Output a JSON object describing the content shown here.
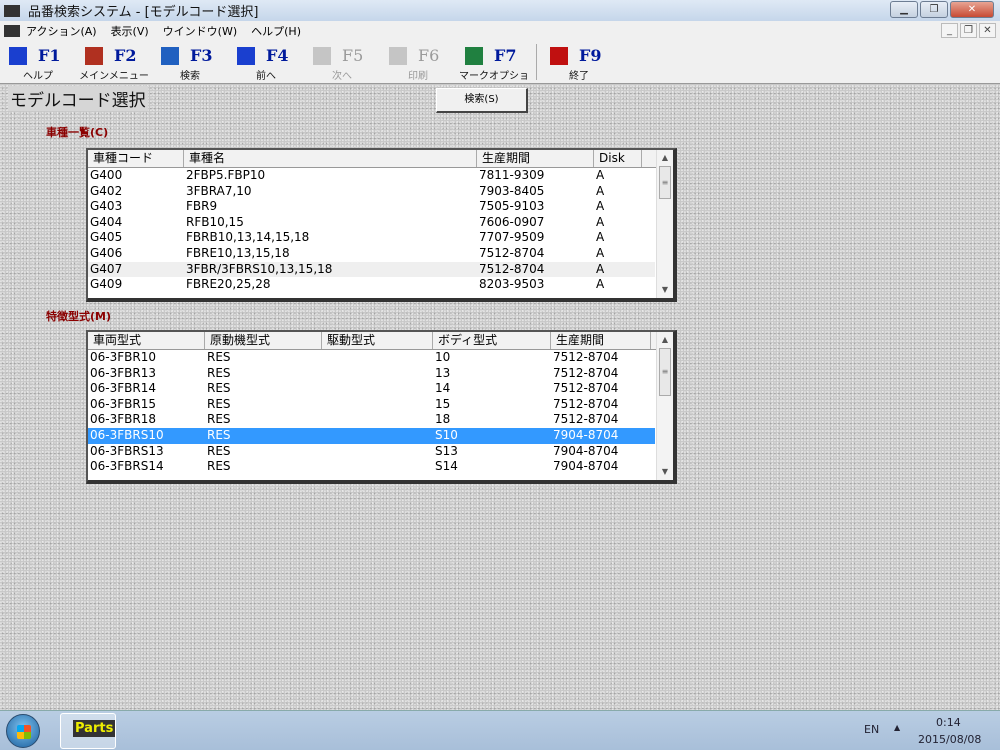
{
  "window": {
    "title": "品番検索システム - [モデルコード選択]",
    "app_icon": "Parts"
  },
  "menu": [
    "アクション(A)",
    "表示(V)",
    "ウインドウ(W)",
    "ヘルプ(H)"
  ],
  "toolbar": [
    {
      "key": "F1",
      "label": "ヘルプ",
      "icon": "help-icon",
      "enabled": true,
      "color": "#1a3fcf"
    },
    {
      "key": "F2",
      "label": "メインメニュー",
      "icon": "home-icon",
      "enabled": true,
      "color": "#b03020"
    },
    {
      "key": "F3",
      "label": "検索",
      "icon": "search-icon",
      "enabled": true,
      "color": "#2060c0"
    },
    {
      "key": "F4",
      "label": "前へ",
      "icon": "back-icon",
      "enabled": true,
      "color": "#1a3fcf"
    },
    {
      "key": "F5",
      "label": "次へ",
      "icon": "next-icon",
      "enabled": false,
      "color": "#999999"
    },
    {
      "key": "F6",
      "label": "印刷",
      "icon": "print-icon",
      "enabled": false,
      "color": "#999999"
    },
    {
      "key": "F7",
      "label": "マークオプション",
      "icon": "mark-option-icon",
      "enabled": true,
      "color": "#208040"
    },
    {
      "key": "F9",
      "label": "終了",
      "icon": "exit-icon",
      "enabled": true,
      "color": "#c01010"
    }
  ],
  "page": {
    "title": "モデルコード選択",
    "search_button": "検索(S)"
  },
  "model_list": {
    "label": "車種一覧(C)",
    "columns": [
      "車種コード",
      "車種名",
      "生産期間",
      "Disk"
    ],
    "rows": [
      [
        "G400",
        "2FBP5.FBP10",
        "7811-9309",
        "A"
      ],
      [
        "G402",
        "3FBRA7,10",
        "7903-8405",
        "A"
      ],
      [
        "G403",
        "FBR9",
        "7505-9103",
        "A"
      ],
      [
        "G404",
        "RFB10,15",
        "7606-0907",
        "A"
      ],
      [
        "G405",
        "FBRB10,13,14,15,18",
        "7707-9509",
        "A"
      ],
      [
        "G406",
        "FBRE10,13,15,18",
        "7512-8704",
        "A"
      ],
      [
        "G407",
        "3FBR/3FBRS10,13,15,18",
        "7512-8704",
        "A"
      ],
      [
        "G409",
        "FBRE20,25,28",
        "8203-9503",
        "A"
      ]
    ],
    "highlighted_row": 6
  },
  "type_list": {
    "label": "特徴型式(M)",
    "columns": [
      "車両型式",
      "原動機型式",
      "駆動型式",
      "ボディ型式",
      "生産期間"
    ],
    "rows": [
      [
        "06-3FBR10",
        "RES",
        "",
        "10",
        "7512-8704"
      ],
      [
        "06-3FBR13",
        "RES",
        "",
        "13",
        "7512-8704"
      ],
      [
        "06-3FBR14",
        "RES",
        "",
        "14",
        "7512-8704"
      ],
      [
        "06-3FBR15",
        "RES",
        "",
        "15",
        "7512-8704"
      ],
      [
        "06-3FBR18",
        "RES",
        "",
        "18",
        "7512-8704"
      ],
      [
        "06-3FBRS10",
        "RES",
        "",
        "S10",
        "7904-8704"
      ],
      [
        "06-3FBRS13",
        "RES",
        "",
        "S13",
        "7904-8704"
      ],
      [
        "06-3FBRS14",
        "RES",
        "",
        "S14",
        "7904-8704"
      ]
    ],
    "selected_row": 5
  },
  "taskbar": {
    "app": "Parts",
    "lang": "EN",
    "time": "0:14",
    "date": "2015/08/08"
  }
}
